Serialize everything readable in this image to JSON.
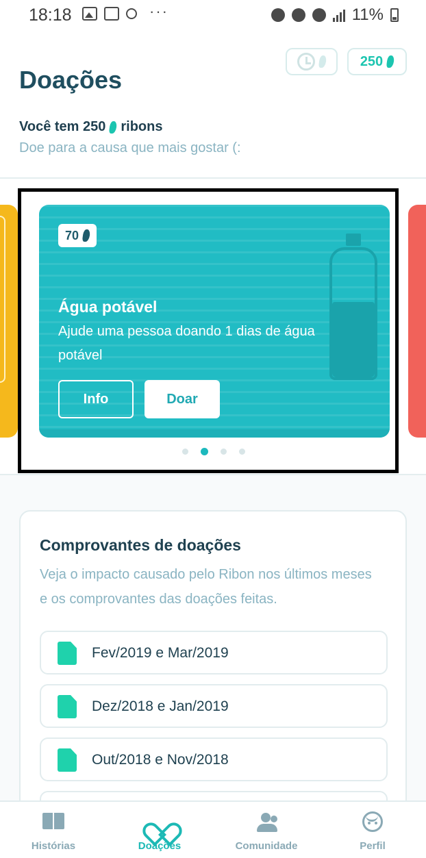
{
  "status_bar": {
    "time": "18:18",
    "battery": "11%"
  },
  "header": {
    "title": "Doações",
    "balance": "250",
    "history_icon": "clock-icon",
    "currency_icon": "ribbon-icon"
  },
  "intro": {
    "have_prefix": "Você tem 250",
    "have_suffix": "ribons",
    "subtitle": "Doe para a causa que mais gostar (:"
  },
  "carousel": {
    "active_index": 1,
    "dot_count": 4,
    "card": {
      "cost": "70",
      "title": "Água potável",
      "description": "Ajude uma pessoa doando 1 dias de água potável",
      "info_label": "Info",
      "donate_label": "Doar",
      "color": "#21bcc4"
    },
    "peek_left_color": "#f5b81c",
    "peek_right_color": "#f1625a"
  },
  "receipts": {
    "title": "Comprovantes de doações",
    "description": "Veja o impacto causado pelo Ribon nos últimos meses e os comprovantes das doações feitas.",
    "items": [
      {
        "label": "Fev/2019 e Mar/2019"
      },
      {
        "label": "Dez/2018 e Jan/2019"
      },
      {
        "label": "Out/2018 e Nov/2018"
      }
    ]
  },
  "bottom_nav": {
    "items": [
      {
        "label": "Histórias",
        "icon": "book-icon"
      },
      {
        "label": "Doações",
        "icon": "heart-icon",
        "active": true
      },
      {
        "label": "Comunidade",
        "icon": "people-icon"
      },
      {
        "label": "Perfil",
        "icon": "face-icon"
      }
    ]
  },
  "colors": {
    "accent": "#1cc5b0",
    "title": "#1f4e5f",
    "muted": "#8ab4c2"
  }
}
